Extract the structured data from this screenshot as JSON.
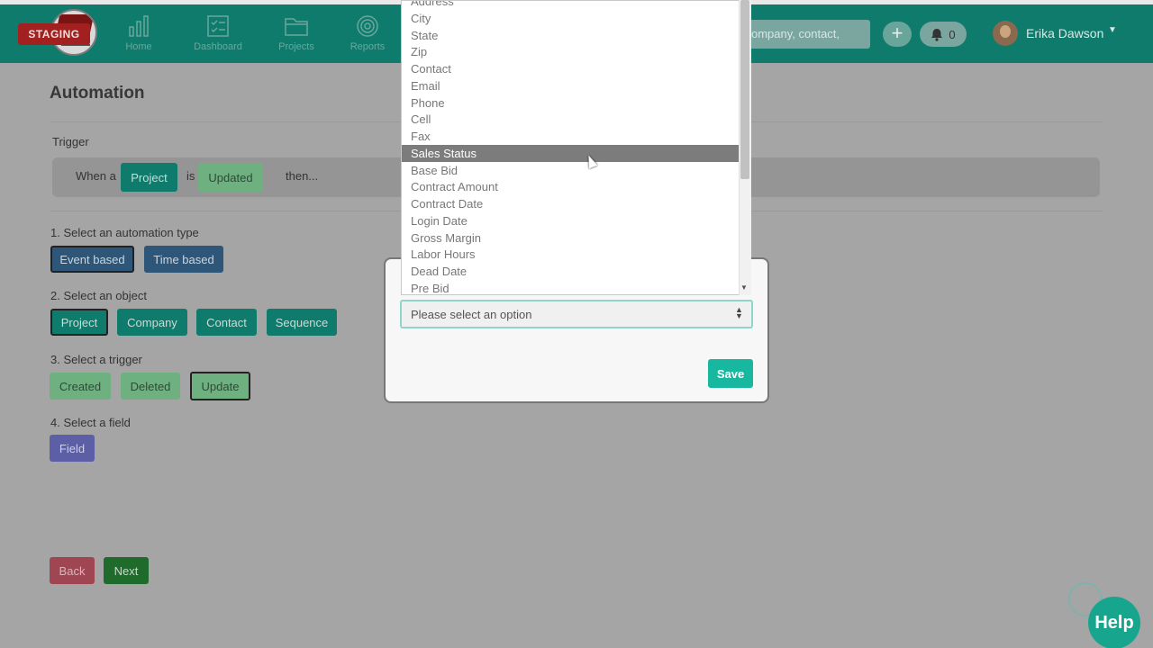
{
  "nav": {
    "staging_label": "STAGING",
    "items": [
      {
        "label": "Home",
        "icon": "bar-chart-icon"
      },
      {
        "label": "Dashboard",
        "icon": "checklist-icon"
      },
      {
        "label": "Projects",
        "icon": "folder-icon"
      },
      {
        "label": "Reports",
        "icon": "target-icon"
      }
    ],
    "search_placeholder": "ompany, contact,",
    "notification_count": "0",
    "user_name": "Erika Dawson"
  },
  "page": {
    "title": "Automation",
    "trigger_label": "Trigger",
    "trigger_sentence": {
      "when_a": "When a",
      "object": "Project",
      "is": "is",
      "action": "Updated",
      "then": "then..."
    },
    "steps": [
      {
        "label": "1. Select an automation type",
        "options": [
          "Event based",
          "Time based"
        ],
        "selected": "Event based"
      },
      {
        "label": "2. Select an object",
        "options": [
          "Project",
          "Company",
          "Contact",
          "Sequence"
        ],
        "selected": "Project"
      },
      {
        "label": "3. Select a trigger",
        "options": [
          "Created",
          "Deleted",
          "Update"
        ],
        "selected": "Update"
      },
      {
        "label": "4. Select a field",
        "options": [
          "Field"
        ],
        "selected": "Field"
      }
    ],
    "back_label": "Back",
    "next_label": "Next"
  },
  "modal": {
    "select_placeholder": "Please select an option",
    "save_label": "Save"
  },
  "dropdown": {
    "options": [
      "Address",
      "City",
      "State",
      "Zip",
      "Contact",
      "Email",
      "Phone",
      "Cell",
      "Fax",
      "Sales Status",
      "Base Bid",
      "Contract Amount",
      "Contract Date",
      "Login Date",
      "Gross Margin",
      "Labor Hours",
      "Dead Date",
      "Pre Bid"
    ],
    "highlighted": "Sales Status"
  },
  "help_label": "Help"
}
